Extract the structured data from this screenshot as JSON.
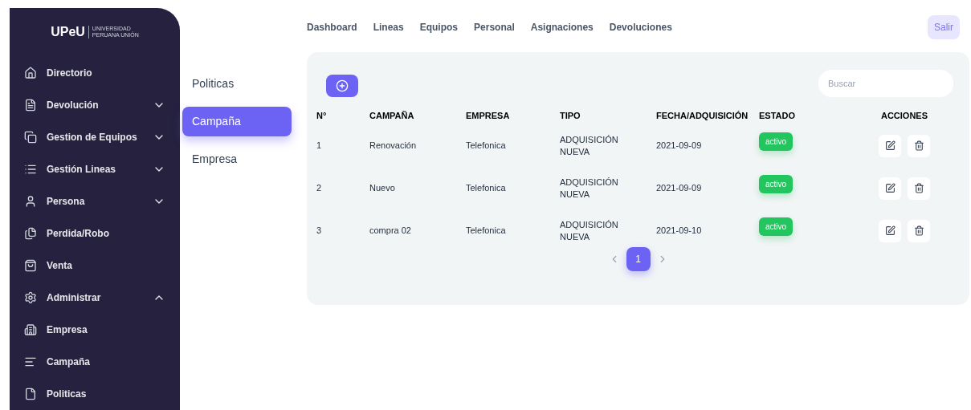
{
  "logo": {
    "mark": "UPeU",
    "line_1": "UNIVERSIDAD",
    "line_2": "PERUANA UNIÓN"
  },
  "sidebar": {
    "items": [
      {
        "kind": "home",
        "label": "Directorio"
      },
      {
        "kind": "doc",
        "label": "Devolución",
        "expanded": false
      },
      {
        "kind": "devices",
        "label": "Gestion de Equipos",
        "expanded": false
      },
      {
        "kind": "list",
        "label": "Gestión Lineas",
        "expanded": false
      },
      {
        "kind": "user",
        "label": "Persona",
        "expanded": false
      },
      {
        "kind": "copy",
        "label": "Perdida/Robo"
      },
      {
        "kind": "bag",
        "label": "Venta"
      },
      {
        "kind": "gear",
        "label": "Administrar",
        "expanded": true,
        "children": [
          {
            "kind": "building",
            "label": "Empresa"
          },
          {
            "kind": "chart",
            "label": "Campaña"
          },
          {
            "kind": "file",
            "label": "Politicas"
          }
        ]
      }
    ]
  },
  "submenu": [
    {
      "label": "Politicas",
      "selected": false
    },
    {
      "label": "Campaña",
      "selected": true
    },
    {
      "label": "Empresa",
      "selected": false
    }
  ],
  "nav": [
    "Dashboard",
    "Lineas",
    "Equipos",
    "Personal",
    "Asignaciones",
    "Devoluciones"
  ],
  "logout": "Salir",
  "search": {
    "placeholder": "Buscar"
  },
  "table": {
    "columns": [
      "N°",
      "CAMPAÑA",
      "EMPRESA",
      "TIPO",
      "FECHA/ADQUISICIÓN",
      "ESTADO",
      "ACCIONES"
    ],
    "rows": [
      {
        "n": "1",
        "campaign": "Renovación",
        "company": "Telefonica",
        "type": "ADQUISICIÓN NUEVA",
        "date": "2021-09-09",
        "status": "activo"
      },
      {
        "n": "2",
        "campaign": "Nuevo",
        "company": "Telefonica",
        "type": "ADQUISICIÓN NUEVA",
        "date": "2021-09-09",
        "status": "activo"
      },
      {
        "n": "3",
        "campaign": "compra 02",
        "company": "Telefonica",
        "type": "ADQUISICIÓN NUEVA",
        "date": "2021-09-10",
        "status": "activo"
      }
    ]
  },
  "pagination": {
    "pages": [
      {
        "label": "1",
        "selected": true
      }
    ]
  }
}
